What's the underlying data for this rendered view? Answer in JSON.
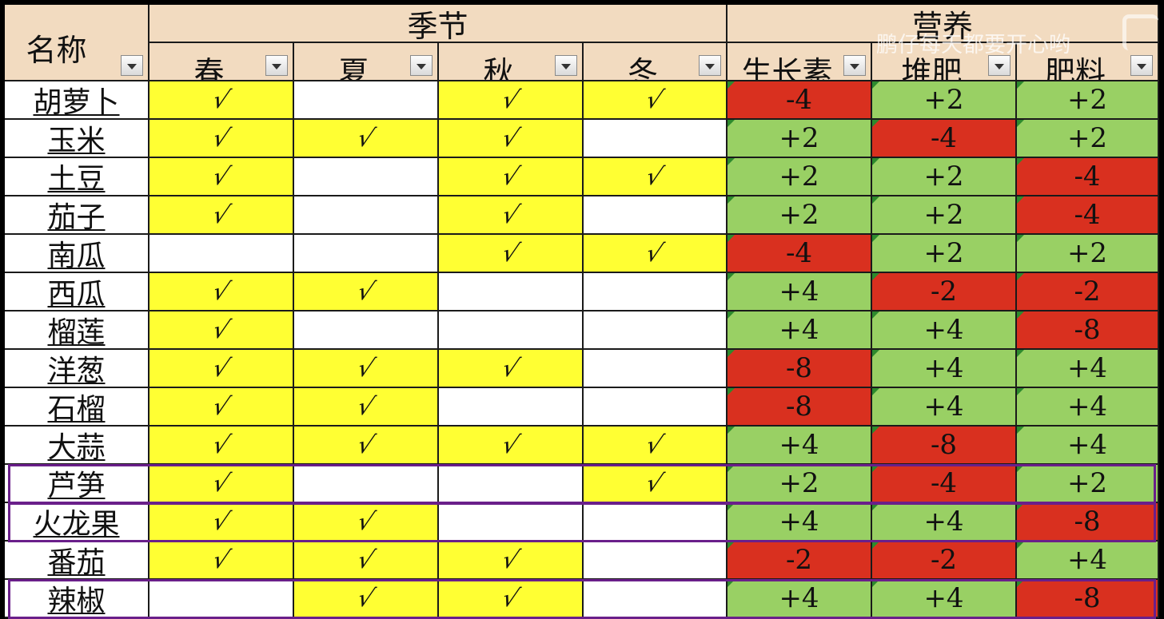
{
  "header": {
    "name_label": "名称",
    "season_group": "季节",
    "nutrition_group": "营养",
    "seasons": [
      "春",
      "夏",
      "秋",
      "冬"
    ],
    "nutrients": [
      "生长素",
      "堆肥",
      "肥料"
    ]
  },
  "check_mark": "√",
  "watermark": "鹏仔每天都要开心哟",
  "rows": [
    {
      "name": "胡萝卜",
      "seasons": [
        true,
        false,
        true,
        true
      ],
      "nutrients": [
        "-4",
        "+2",
        "+2"
      ]
    },
    {
      "name": "玉米",
      "seasons": [
        true,
        true,
        true,
        false
      ],
      "nutrients": [
        "+2",
        "-4",
        "+2"
      ]
    },
    {
      "name": "土豆",
      "seasons": [
        true,
        false,
        true,
        true
      ],
      "nutrients": [
        "+2",
        "+2",
        "-4"
      ]
    },
    {
      "name": "茄子",
      "seasons": [
        true,
        false,
        true,
        false
      ],
      "nutrients": [
        "+2",
        "+2",
        "-4"
      ]
    },
    {
      "name": "南瓜",
      "seasons": [
        false,
        false,
        true,
        true
      ],
      "nutrients": [
        "-4",
        "+2",
        "+2"
      ]
    },
    {
      "name": "西瓜",
      "seasons": [
        true,
        true,
        false,
        false
      ],
      "nutrients": [
        "+4",
        "-2",
        "-2"
      ]
    },
    {
      "name": "榴莲",
      "seasons": [
        true,
        false,
        false,
        false
      ],
      "nutrients": [
        "+4",
        "+4",
        "-8"
      ]
    },
    {
      "name": "洋葱",
      "seasons": [
        true,
        true,
        true,
        false
      ],
      "nutrients": [
        "-8",
        "+4",
        "+4"
      ]
    },
    {
      "name": "石榴",
      "seasons": [
        true,
        true,
        false,
        false
      ],
      "nutrients": [
        "-8",
        "+4",
        "+4"
      ]
    },
    {
      "name": "大蒜",
      "seasons": [
        true,
        true,
        true,
        true
      ],
      "nutrients": [
        "+4",
        "-8",
        "+4"
      ]
    },
    {
      "name": "芦笋",
      "seasons": [
        true,
        false,
        false,
        true
      ],
      "nutrients": [
        "+2",
        "-4",
        "+2"
      ],
      "highlighted": true
    },
    {
      "name": "火龙果",
      "seasons": [
        true,
        true,
        false,
        false
      ],
      "nutrients": [
        "+4",
        "+4",
        "-8"
      ],
      "highlighted": true
    },
    {
      "name": "番茄",
      "seasons": [
        true,
        true,
        true,
        false
      ],
      "nutrients": [
        "-2",
        "-2",
        "+4"
      ]
    },
    {
      "name": "辣椒",
      "seasons": [
        false,
        true,
        true,
        false
      ],
      "nutrients": [
        "+4",
        "+4",
        "-8"
      ],
      "highlighted": true
    }
  ],
  "colors": {
    "header_bg": "#f2dbc0",
    "season_yes": "#ffff33",
    "nutrient_positive": "#99d064",
    "nutrient_negative": "#d9301f",
    "selection_border": "#6a1f8a"
  }
}
